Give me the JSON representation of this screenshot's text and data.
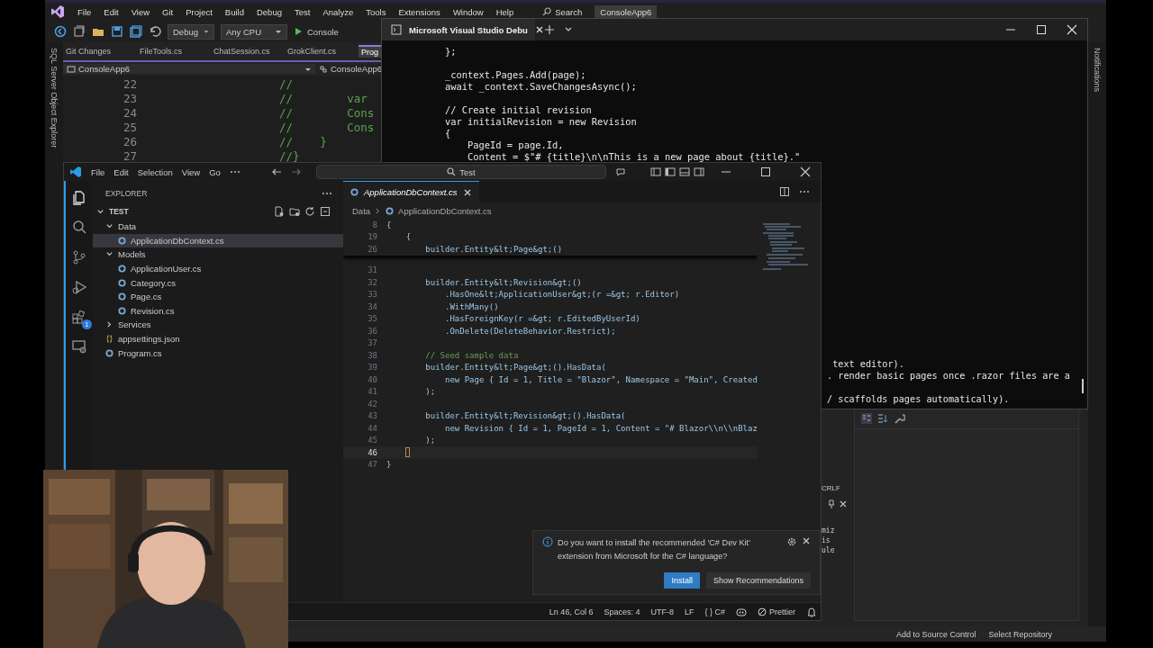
{
  "vs": {
    "menu": [
      "File",
      "Edit",
      "View",
      "Git",
      "Project",
      "Build",
      "Debug",
      "Test",
      "Analyze",
      "Tools",
      "Extensions",
      "Window",
      "Help"
    ],
    "search": "Search",
    "solution": "ConsoleApp6",
    "toolbar": {
      "configuration": "Debug",
      "platform": "Any CPU",
      "run": "Console"
    },
    "doc_tabs": [
      {
        "label": "Git Changes",
        "selected": false
      },
      {
        "label": "FileTools.cs",
        "selected": false
      },
      {
        "label": "ChatSession.cs",
        "selected": false
      },
      {
        "label": "GrokClient.cs",
        "selected": false
      },
      {
        "label": "Prog",
        "selected": true
      }
    ],
    "nav": [
      "ConsoleApp6",
      "ConsoleApp6"
    ],
    "code_lines": [
      {
        "number": "22",
        "text": "//"
      },
      {
        "number": "23",
        "text": "//        var"
      },
      {
        "number": "24",
        "text": "//        Cons"
      },
      {
        "number": "25",
        "text": "//        Cons"
      },
      {
        "number": "26",
        "text": "//    }"
      },
      {
        "number": "27",
        "text": "//}"
      }
    ],
    "left_tab": "SQL Server Object Explorer",
    "right_tab": "Notifications",
    "lower_panel": {
      "line_ending": "CRLF",
      "fragments": [
        "miz",
        "is",
        "ule"
      ]
    },
    "status": [
      "Add to Source Control",
      "Select Repository"
    ]
  },
  "terminal": {
    "tab": "Microsoft Visual Studio Debu",
    "blocks": [
      [
        "        };"
      ],
      [
        "        _context.Pages.Add(page);",
        "        await _context.SaveChangesAsync();"
      ],
      [
        "        // Create initial revision",
        "        var initialRevision = new Revision",
        "        {",
        "            PageId = page.Id,",
        "            Content = $\"# {title}\\n\\nThis is a new page about {title}.\""
      ]
    ],
    "tail_blocks": [
      [
        " text editor).",
        ". render basic pages once .razor files are a"
      ],
      [
        "/ scaffolds pages automatically)."
      ]
    ]
  },
  "vscode": {
    "menu": [
      "File",
      "Edit",
      "Selection",
      "View",
      "Go"
    ],
    "search": "Test",
    "explorer": {
      "title": "EXPLORER",
      "root": "TEST",
      "items": [
        {
          "label": "Data",
          "kind": "folder",
          "expanded": true,
          "selected": false,
          "children": [
            {
              "label": "ApplicationDbContext.cs",
              "kind": "csharp",
              "selected": true
            }
          ]
        },
        {
          "label": "Models",
          "kind": "folder",
          "expanded": true,
          "selected": false,
          "children": [
            {
              "label": "ApplicationUser.cs",
              "kind": "csharp",
              "selected": false
            },
            {
              "label": "Category.cs",
              "kind": "csharp",
              "selected": false
            },
            {
              "label": "Page.cs",
              "kind": "csharp",
              "selected": false
            },
            {
              "label": "Revision.cs",
              "kind": "csharp",
              "selected": false
            }
          ]
        },
        {
          "label": "Services",
          "kind": "folder",
          "expanded": false,
          "selected": false
        },
        {
          "label": "appsettings.json",
          "kind": "json",
          "selected": false
        },
        {
          "label": "Program.cs",
          "kind": "csharp",
          "selected": false
        }
      ]
    },
    "extensions_badge": "1",
    "tab": "ApplicationDbContext.cs",
    "breadcrumb": [
      "Data",
      "ApplicationDbContext.cs"
    ],
    "sticky_lines": [
      {
        "number": "8",
        "text": "{",
        "kind": "code"
      },
      {
        "number": "19",
        "text": "    {",
        "kind": "code"
      },
      {
        "number": "26",
        "text": "        builder.Entity&lt;Page&gt;()",
        "kind": "code"
      }
    ],
    "lines": [
      {
        "number": "31",
        "current": false
      },
      {
        "number": "32",
        "text": "        builder.Entity&lt;Revision&gt;()",
        "kind": "code",
        "current": false
      },
      {
        "number": "33",
        "text": "            .HasOne&lt;ApplicationUser&gt;(r =&gt; r.Editor)",
        "kind": "code",
        "current": false
      },
      {
        "number": "34",
        "text": "            .WithMany()",
        "kind": "code",
        "current": false
      },
      {
        "number": "35",
        "text": "            .HasForeignKey(r =&gt; r.EditedByUserId)",
        "kind": "code",
        "current": false
      },
      {
        "number": "36",
        "text": "            .OnDelete(DeleteBehavior.Restrict);",
        "kind": "code",
        "current": false
      },
      {
        "number": "37",
        "current": false
      },
      {
        "number": "38",
        "text": "        // Seed sample data",
        "kind": "comment",
        "current": false
      },
      {
        "number": "39",
        "text": "        builder.Entity&lt;Page&gt;().HasData(",
        "kind": "code",
        "current": false
      },
      {
        "number": "40",
        "text": "            new Page { Id = 1, Title = \"Blazor\", Namespace = \"Main\", Created",
        "kind": "code",
        "current": false
      },
      {
        "number": "41",
        "text": "        );",
        "kind": "code",
        "current": false
      },
      {
        "number": "42",
        "current": false
      },
      {
        "number": "43",
        "text": "        builder.Entity&lt;Revision&gt;().HasData(",
        "kind": "code",
        "current": false
      },
      {
        "number": "44",
        "text": "            new Revision { Id = 1, PageId = 1, Content = \"# Blazor\\\\n\\\\nBlaz",
        "kind": "code",
        "current": false
      },
      {
        "number": "45",
        "text": "        );",
        "kind": "code",
        "current": false
      },
      {
        "number": "46",
        "current": true
      },
      {
        "number": "47",
        "text": "}",
        "kind": "code",
        "current": false
      }
    ],
    "notification": {
      "message": "Do you want to install the recommended 'C# Dev Kit' extension from Microsoft for the C# language?",
      "buttons": [
        {
          "label": "Install",
          "primary": true
        },
        {
          "label": "Show Recommendations",
          "primary": false
        }
      ]
    },
    "status": [
      "Ln 46, Col 6",
      "Spaces: 4",
      "UTF-8",
      "LF",
      "{ } C#"
    ],
    "formatter": "Prettier"
  }
}
